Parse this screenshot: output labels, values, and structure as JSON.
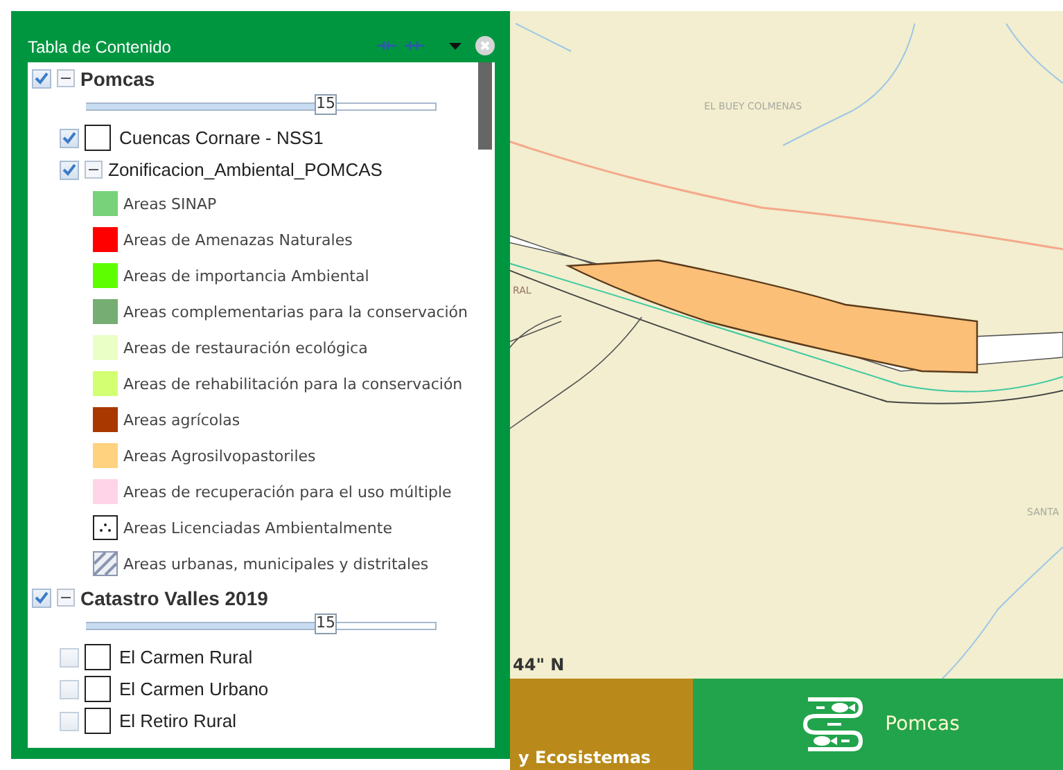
{
  "panel": {
    "title": "Tabla de Contenido",
    "groups": [
      {
        "label": "Pomcas",
        "checked": true,
        "expanded": true,
        "opacity_label": "15",
        "level": 0.68,
        "layers": [
          {
            "kind": "layer",
            "label": "Cuencas Cornare - NSS1",
            "checked": true
          },
          {
            "kind": "sublayer",
            "label": "Zonificacion_Ambiental_POMCAS",
            "checked": true,
            "expanded": true,
            "legend": [
              {
                "kind": "fill",
                "label": "Areas SINAP",
                "color": "#77d27a"
              },
              {
                "kind": "fill",
                "label": "Areas de Amenazas Naturales",
                "color": "#ff0000"
              },
              {
                "kind": "fill",
                "label": "Areas de importancia Ambiental",
                "color": "#5dff00"
              },
              {
                "kind": "fill",
                "label": "Areas complementarias para la conservación",
                "color": "#76ad73"
              },
              {
                "kind": "fill",
                "label": "Areas de restauración ecológica",
                "color": "#eaffc6"
              },
              {
                "kind": "fill",
                "label": "Areas de rehabilitación para la conservación",
                "color": "#d3ff72"
              },
              {
                "kind": "fill",
                "label": "Areas agrícolas",
                "color": "#a83800"
              },
              {
                "kind": "fill",
                "label": "Areas Agrosilvopastoriles",
                "color": "#ffd27f"
              },
              {
                "kind": "fill",
                "label": "Areas de recuperación para el uso múltiple",
                "color": "#ffd3e8"
              },
              {
                "kind": "dots",
                "label": "Areas Licenciadas Ambientalmente"
              },
              {
                "kind": "hatch",
                "label": "Areas urbanas, municipales y distritales"
              }
            ]
          }
        ]
      },
      {
        "label": "Catastro Valles 2019",
        "checked": true,
        "expanded": true,
        "opacity_label": "15",
        "level": 0.68,
        "layers": [
          {
            "kind": "layer",
            "label": "El Carmen Rural",
            "checked": false
          },
          {
            "kind": "layer",
            "label": "El Carmen Urbano",
            "checked": false
          },
          {
            "kind": "layer",
            "label": "El Retiro Rural",
            "checked": false
          }
        ]
      }
    ]
  },
  "map": {
    "labels": [
      "EL BUEY COLMENAS",
      "RAL",
      "SANTA",
      "44\" N"
    ]
  },
  "bottom_tiles": [
    {
      "label": "y Ecosistemas",
      "color": "#b98a1a"
    },
    {
      "label": "Pomcas",
      "color": "#22a44c"
    }
  ]
}
